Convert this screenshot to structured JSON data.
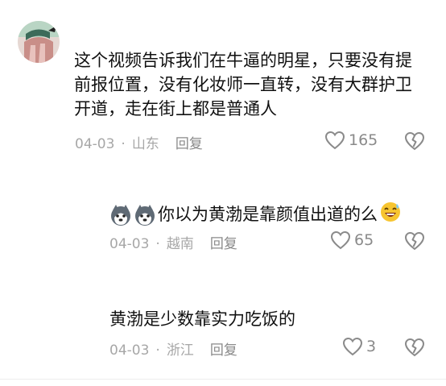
{
  "comment_main": {
    "username": "",
    "text": "这个视频告诉我们在牛逼的明星，只要没有提前报位置，没有化妆师一直转，没有大群护卫开道，走在街上都是普通人",
    "date": "04-03",
    "location": "山东",
    "reply_label": "回复",
    "likes": "165"
  },
  "reply_1": {
    "username": "",
    "text": "你以为黄渤是靠颜值出道的么",
    "date": "04-03",
    "location": "越南",
    "reply_label": "回复",
    "likes": "65"
  },
  "reply_2": {
    "username": "",
    "text": "黄渤是少数靠实力吃饭的",
    "date": "04-03",
    "location": "浙江",
    "reply_label": "回复",
    "likes": "3"
  },
  "icons": {
    "like": "heart-outline-icon",
    "dislike": "broken-heart-icon",
    "emoji_dogs": "husky-face-emoji",
    "emoji_laugh": "laughing-sweat-emoji"
  },
  "colors": {
    "text": "#111111",
    "meta": "#a7a7a7",
    "icon": "#8a8a8a"
  }
}
